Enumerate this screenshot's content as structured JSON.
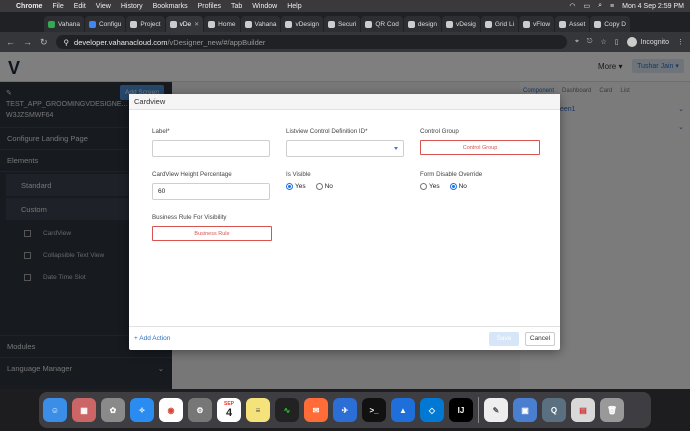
{
  "menubar": {
    "items": [
      "Chrome",
      "File",
      "Edit",
      "View",
      "History",
      "Bookmarks",
      "Profiles",
      "Tab",
      "Window",
      "Help"
    ],
    "datetime": "Mon 4 Sep  2:59 PM"
  },
  "tabs": [
    "Vahana",
    "Configu",
    "Project",
    "vDe",
    "Home",
    "Vahana",
    "vDesign",
    "Securi",
    "QR Cod",
    "design",
    "vDesig",
    "Grid Li",
    "vFlow",
    "Asset",
    "Copy D"
  ],
  "urlbar": {
    "domain": "developer.vahanacloud.com",
    "path": "/vDesigner_new/#/appBuilder",
    "profile": "Incognito"
  },
  "header": {
    "more": "More",
    "user": "Tushar Jain"
  },
  "sidebar": {
    "add_screen": "Add Screen",
    "project_name": "TEST_APP_GROOMINGVDESIGNE...",
    "project_id": "W3JZSMWF64",
    "configure": "Configure Landing Page",
    "elements": "Elements",
    "standard": "Standard",
    "custom": "Custom",
    "items": [
      "CardView",
      "Collapsible Text View",
      "Date Time Slot"
    ],
    "modules": "Modules",
    "language": "Language Manager"
  },
  "rightpanel": {
    "tabs": [
      "Component",
      "Dashboard",
      "Card",
      "List"
    ],
    "row1": "een1"
  },
  "modal": {
    "title": "Cardview",
    "label_label": "Label*",
    "label_value": "",
    "listview_label": "Listview Control Definition ID*",
    "control_group_label": "Control Group",
    "control_group_btn": "Control Group",
    "height_label": "CardView Height Percentage",
    "height_value": "60",
    "visible_label": "Is Visible",
    "visible_yes": "Yes",
    "visible_no": "No",
    "form_disable_label": "Form Disable Override",
    "form_yes": "Yes",
    "form_no": "No",
    "rule_label": "Business Rule For Visibility",
    "rule_btn": "Business Rule",
    "add_action": "+ Add Action",
    "save": "Save",
    "cancel": "Cancel"
  },
  "dock": {
    "calendar_month": "SEP",
    "calendar_day": "4",
    "apps": [
      "finder-icon",
      "launchpad-icon",
      "photos-icon",
      "safari-icon",
      "chrome-icon",
      "settings-icon",
      "calendar-icon",
      "notes-icon",
      "activity-monitor-icon",
      "postman-icon",
      "mail-icon",
      "terminal-icon",
      "keynote-icon",
      "vscode-icon",
      "intellij-icon",
      "textedit-icon",
      "preview-icon",
      "quicktime-icon",
      "archive-icon",
      "trash-icon"
    ]
  }
}
